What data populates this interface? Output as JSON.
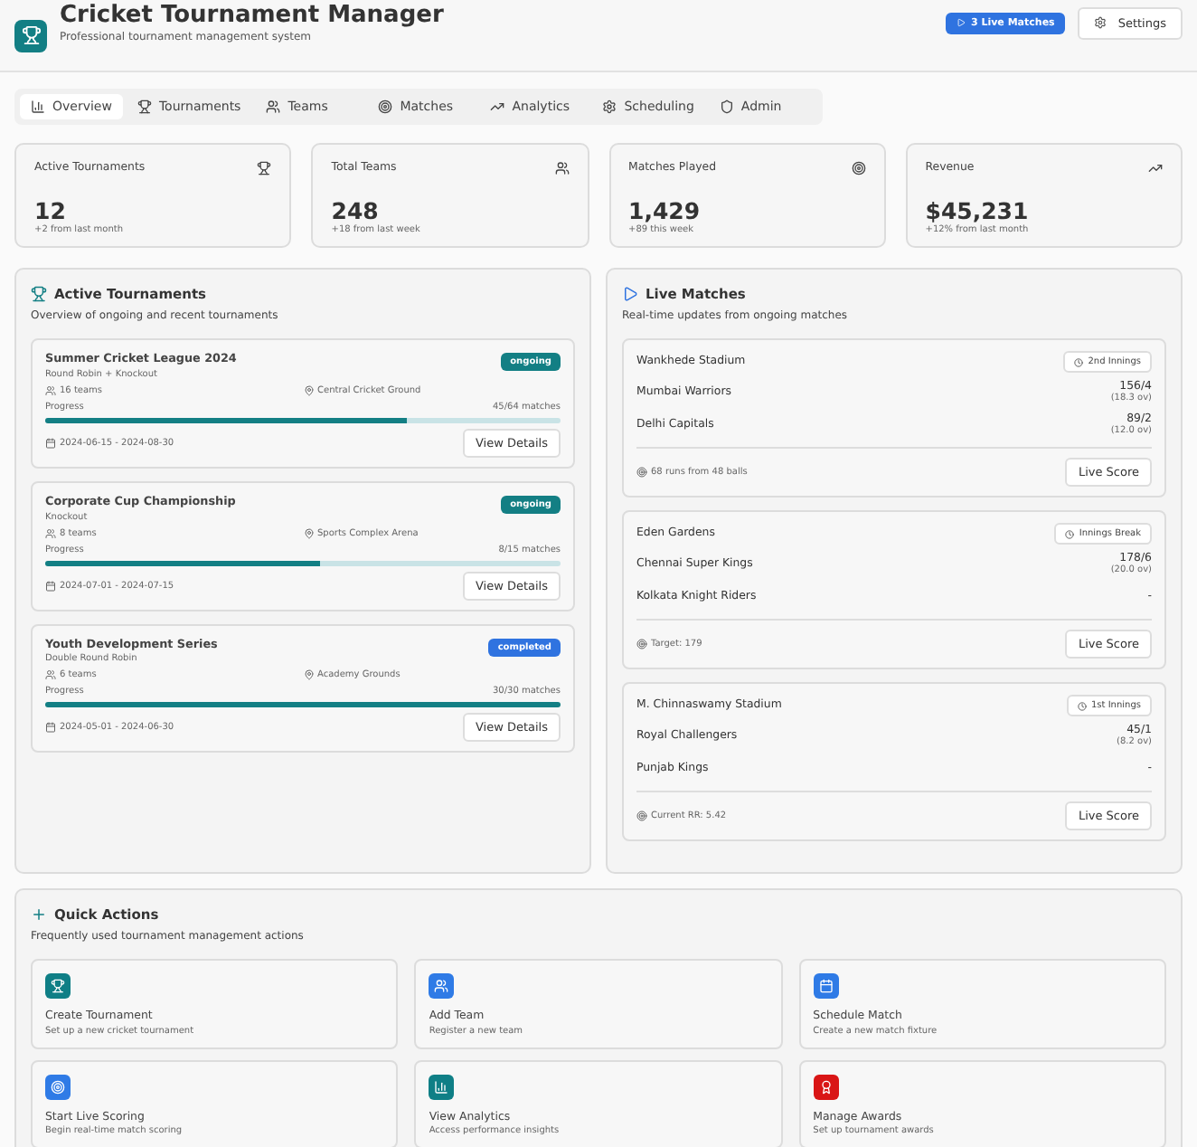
{
  "header": {
    "title": "Cricket Tournament Manager",
    "subtitle": "Professional tournament management system",
    "live_button": "3 Live Matches",
    "settings_button": "Settings"
  },
  "tabs": [
    {
      "label": "Overview",
      "selected": true
    },
    {
      "label": "Tournaments",
      "selected": false
    },
    {
      "label": "Teams",
      "selected": false
    },
    {
      "label": "Matches",
      "selected": false
    },
    {
      "label": "Analytics",
      "selected": false
    },
    {
      "label": "Scheduling",
      "selected": false
    },
    {
      "label": "Admin",
      "selected": false
    }
  ],
  "stats": [
    {
      "label": "Active Tournaments",
      "value": "12",
      "note": "+2 from last month"
    },
    {
      "label": "Total Teams",
      "value": "248",
      "note": "+18 from last week"
    },
    {
      "label": "Matches Played",
      "value": "1,429",
      "note": "+89 this week"
    },
    {
      "label": "Revenue",
      "value": "$45,231",
      "note": "+12% from last month"
    }
  ],
  "tournaments_panel": {
    "title": "Active Tournaments",
    "subtitle": "Overview of ongoing and recent tournaments",
    "items": [
      {
        "name": "Summer Cricket League 2024",
        "format": "Round Robin + Knockout",
        "status": "ongoing",
        "kind": "ongoing",
        "teams": "16 teams",
        "venue": "Central Cricket Ground",
        "progress_label": "Progress",
        "progress_text": "45/64 matches",
        "level": 0.703,
        "dates": "2024-06-15 - 2024-08-30",
        "button": "View Details"
      },
      {
        "name": "Corporate Cup Championship",
        "format": "Knockout",
        "status": "ongoing",
        "kind": "ongoing",
        "teams": "8 teams",
        "venue": "Sports Complex Arena",
        "progress_label": "Progress",
        "progress_text": "8/15 matches",
        "level": 0.533,
        "dates": "2024-07-01 - 2024-07-15",
        "button": "View Details"
      },
      {
        "name": "Youth Development Series",
        "format": "Double Round Robin",
        "status": "completed",
        "kind": "completed",
        "teams": "6 teams",
        "venue": "Academy Grounds",
        "progress_label": "Progress",
        "progress_text": "30/30 matches",
        "level": 1,
        "dates": "2024-05-01 - 2024-06-30",
        "button": "View Details"
      }
    ]
  },
  "live_panel": {
    "title": "Live Matches",
    "subtitle": "Real-time updates from ongoing matches",
    "items": [
      {
        "venue": "Wankhede Stadium",
        "phase": "2nd Innings",
        "teams": [
          {
            "name": "Mumbai Warriors",
            "score": "156/4",
            "overs": "(18.3 ov)"
          },
          {
            "name": "Delhi Capitals",
            "score": "89/2",
            "overs": "(12.0 ov)"
          }
        ],
        "note": "68 runs from 48 balls",
        "button": "Live Score"
      },
      {
        "venue": "Eden Gardens",
        "phase": "Innings Break",
        "teams": [
          {
            "name": "Chennai Super Kings",
            "score": "178/6",
            "overs": "(20.0 ov)"
          },
          {
            "name": "Kolkata Knight Riders",
            "score": "-"
          }
        ],
        "note": "Target: 179",
        "button": "Live Score"
      },
      {
        "venue": "M. Chinnaswamy Stadium",
        "phase": "1st Innings",
        "teams": [
          {
            "name": "Royal Challengers",
            "score": "45/1",
            "overs": "(8.2 ov)"
          },
          {
            "name": "Punjab Kings",
            "score": "-"
          }
        ],
        "note": "Current RR: 5.42",
        "button": "Live Score"
      }
    ]
  },
  "quick_actions": {
    "title": "Quick Actions",
    "subtitle": "Frequently used tournament management actions",
    "items": [
      {
        "title": "Create Tournament",
        "subtitle": "Set up a new cricket tournament",
        "color": "#0f7f86"
      },
      {
        "title": "Add Team",
        "subtitle": "Register a new team",
        "color": "#2f7be6"
      },
      {
        "title": "Schedule Match",
        "subtitle": "Create a new match fixture",
        "color": "#2f7be6"
      },
      {
        "title": "Start Live Scoring",
        "subtitle": "Begin real-time match scoring",
        "color": "#2f7be6"
      },
      {
        "title": "View Analytics",
        "subtitle": "Access performance insights",
        "color": "#0f7f86"
      },
      {
        "title": "Manage Awards",
        "subtitle": "Set up tournament awards",
        "color": "#d91515"
      }
    ]
  }
}
